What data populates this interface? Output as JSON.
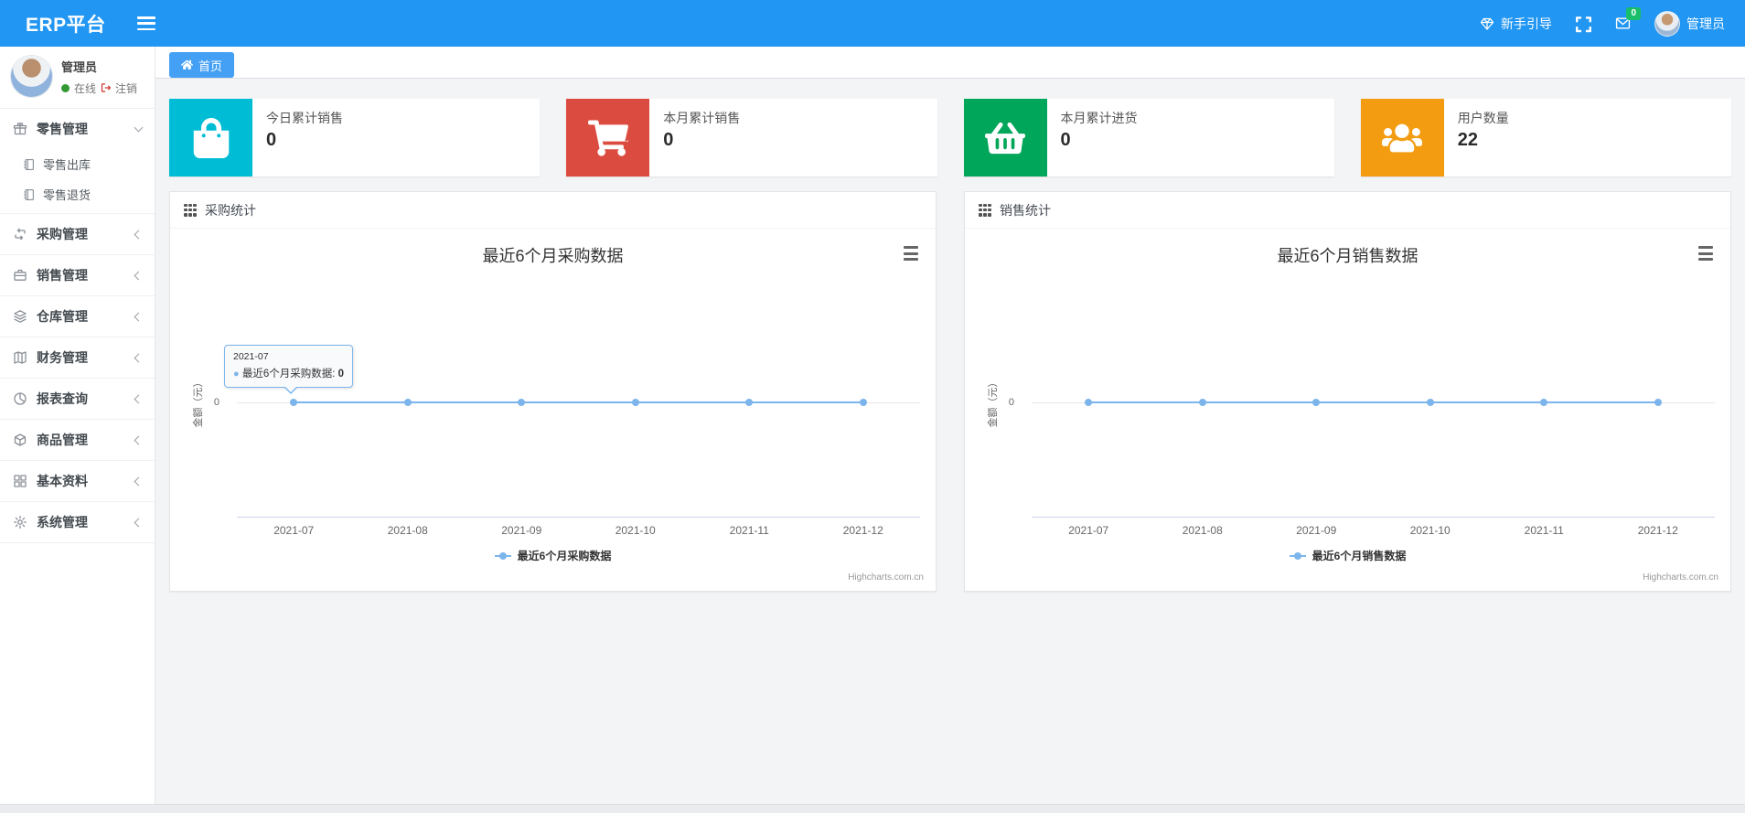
{
  "header": {
    "brand": "ERP平台",
    "menu_icon": "hamburger-icon",
    "guide": {
      "icon": "gem-icon",
      "label": "新手引导"
    },
    "fullscreen_icon": "expand-icon",
    "mail": {
      "icon": "mail-icon",
      "badge": "0"
    },
    "user": {
      "avatar_icon": "avatar",
      "name": "管理员"
    },
    "accent_color": "#2196f3"
  },
  "sidebar": {
    "user": {
      "name": "管理员",
      "status": "在线",
      "logout": "注销",
      "online_color": "#339933"
    },
    "menu": [
      {
        "icon": "gift-icon",
        "label": "零售管理",
        "state": "expanded",
        "children": [
          {
            "icon": "journal-icon",
            "label": "零售出库"
          },
          {
            "icon": "journal-icon",
            "label": "零售退货"
          }
        ]
      },
      {
        "icon": "repeat-icon",
        "label": "采购管理"
      },
      {
        "icon": "briefcase-icon",
        "label": "销售管理"
      },
      {
        "icon": "layers-icon",
        "label": "仓库管理"
      },
      {
        "icon": "map-icon",
        "label": "财务管理"
      },
      {
        "icon": "pie-icon",
        "label": "报表查询"
      },
      {
        "icon": "box-icon",
        "label": "商品管理"
      },
      {
        "icon": "grid-icon",
        "label": "基本资料"
      },
      {
        "icon": "gear-icon",
        "label": "系统管理"
      }
    ]
  },
  "tabs": {
    "home": {
      "icon": "home-icon",
      "label": "首页"
    }
  },
  "stat_cards": [
    {
      "icon": "bag-icon",
      "color": "#00bcd4",
      "label": "今日累计销售",
      "value": "0"
    },
    {
      "icon": "cart-icon",
      "color": "#dc4b3f",
      "label": "本月累计销售",
      "value": "0"
    },
    {
      "icon": "basket-icon",
      "color": "#00a65a",
      "label": "本月累计进货",
      "value": "0"
    },
    {
      "icon": "users-icon",
      "color": "#f39c12",
      "label": "用户数量",
      "value": "22"
    }
  ],
  "panels": [
    {
      "icon": "th-grid-icon",
      "title": "采购统计"
    },
    {
      "icon": "th-grid-icon",
      "title": "销售统计"
    }
  ],
  "chart_data": [
    {
      "type": "line",
      "title": "最近6个月采购数据",
      "x": [
        "2021-07",
        "2021-08",
        "2021-09",
        "2021-10",
        "2021-11",
        "2021-12"
      ],
      "series": [
        {
          "name": "最近6个月采购数据",
          "values": [
            0,
            0,
            0,
            0,
            0,
            0
          ],
          "color": "#7cb5ec"
        }
      ],
      "ylabel": "金额（元）",
      "yticks": [
        "0"
      ],
      "ytick": "0",
      "grid": true,
      "legend_position": "bottom",
      "credits": "Highcharts.com.cn",
      "tooltip": {
        "header": "2021-07",
        "series": "最近6个月采购数据",
        "separator": ": ",
        "value": "0"
      }
    },
    {
      "type": "line",
      "title": "最近6个月销售数据",
      "x": [
        "2021-07",
        "2021-08",
        "2021-09",
        "2021-10",
        "2021-11",
        "2021-12"
      ],
      "series": [
        {
          "name": "最近6个月销售数据",
          "values": [
            0,
            0,
            0,
            0,
            0,
            0
          ],
          "color": "#7cb5ec"
        }
      ],
      "ylabel": "金额（元）",
      "yticks": [
        "0"
      ],
      "ytick": "0",
      "grid": true,
      "legend_position": "bottom",
      "credits": "Highcharts.com.cn"
    }
  ]
}
